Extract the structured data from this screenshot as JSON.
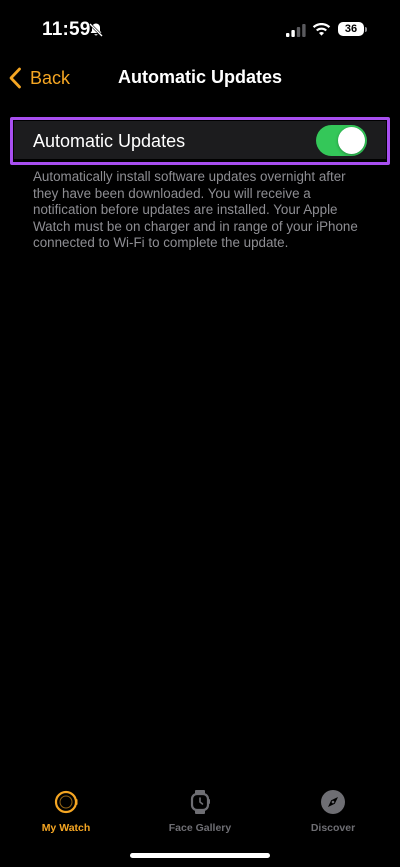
{
  "status_bar": {
    "time": "11:59",
    "battery": "36",
    "icons": [
      "bell-slash-icon",
      "cellular-signal-icon",
      "wifi-icon",
      "battery-icon"
    ]
  },
  "nav": {
    "back_label": "Back",
    "title": "Automatic Updates"
  },
  "setting": {
    "label": "Automatic Updates",
    "toggle_on": true,
    "description": "Automatically install software updates overnight after they have been downloaded. You will receive a notification before updates are installed. Your Apple Watch must be on charger and in range of your iPhone connected to Wi-Fi to complete the update."
  },
  "tabs": [
    {
      "label": "My Watch",
      "icon": "watch-icon",
      "active": true
    },
    {
      "label": "Face Gallery",
      "icon": "watch-face-icon",
      "active": false
    },
    {
      "label": "Discover",
      "icon": "compass-icon",
      "active": false
    }
  ],
  "colors": {
    "accent": "#f5a623",
    "toggle_on": "#34c759",
    "highlight": "#a84ff0",
    "background": "#000000",
    "row_background": "#1c1c1e",
    "secondary_text": "#8e8e93"
  }
}
